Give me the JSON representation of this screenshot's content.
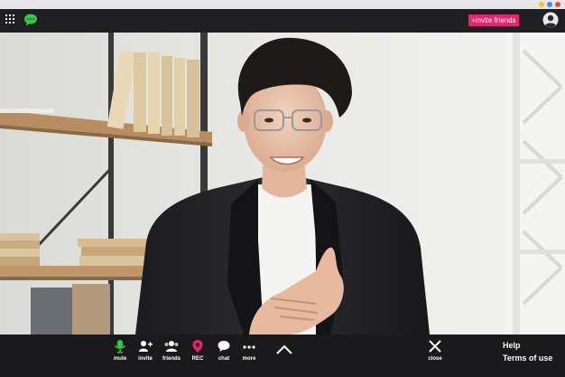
{
  "window": {
    "dots": [
      "#f2c230",
      "#3b8fe8",
      "#e84b3b"
    ]
  },
  "topbar": {
    "invite_label": "+invite friends",
    "icons": [
      "grid-icon",
      "chat-bubble-icon",
      "profile-icon"
    ]
  },
  "controls": [
    {
      "label": "mute",
      "icon": "microphone-icon"
    },
    {
      "label": "invite",
      "icon": "add-user-icon"
    },
    {
      "label": "friends",
      "icon": "users-icon"
    },
    {
      "label": "REC",
      "icon": "record-pin-icon"
    },
    {
      "label": "chat",
      "icon": "speech-bubble-icon"
    },
    {
      "label": "more",
      "icon": "more-dots-icon"
    }
  ],
  "close": {
    "label": "close",
    "icon": "close-icon"
  },
  "footer": {
    "help": "Help",
    "terms": "Terms of use"
  },
  "colors": {
    "accent": "#e8236f",
    "mic_active": "#37c84a",
    "rec": "#e8236f",
    "topbar": "#202022",
    "bottombar": "#1a1a1c"
  }
}
